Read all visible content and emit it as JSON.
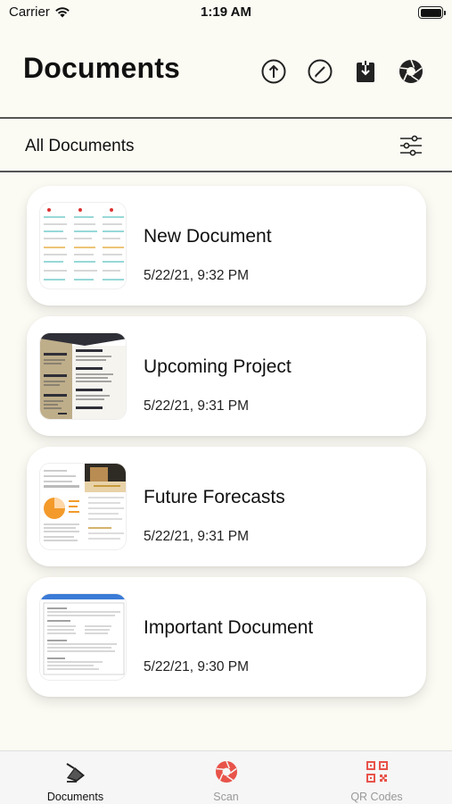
{
  "status_bar": {
    "carrier": "Carrier",
    "time": "1:19 AM"
  },
  "header": {
    "title": "Documents",
    "actions": [
      "upload-icon",
      "edit-icon",
      "download-icon",
      "camera-shutter-icon"
    ]
  },
  "filter": {
    "label": "All Documents",
    "icon": "sliders-icon"
  },
  "documents": [
    {
      "title": "New Document",
      "date": "5/22/21, 9:32 PM"
    },
    {
      "title": "Upcoming Project",
      "date": "5/22/21, 9:31 PM"
    },
    {
      "title": "Future Forecasts",
      "date": "5/22/21, 9:31 PM"
    },
    {
      "title": "Important Document",
      "date": "5/22/21, 9:30 PM"
    }
  ],
  "tabs": [
    {
      "label": "Documents",
      "icon": "scanner-icon",
      "active": true
    },
    {
      "label": "Scan",
      "icon": "shutter-icon",
      "active": false
    },
    {
      "label": "QR Codes",
      "icon": "qr-code-icon",
      "active": false
    }
  ],
  "colors": {
    "background": "#fbfaf3",
    "accent": "#e8534a",
    "card": "#ffffff"
  }
}
